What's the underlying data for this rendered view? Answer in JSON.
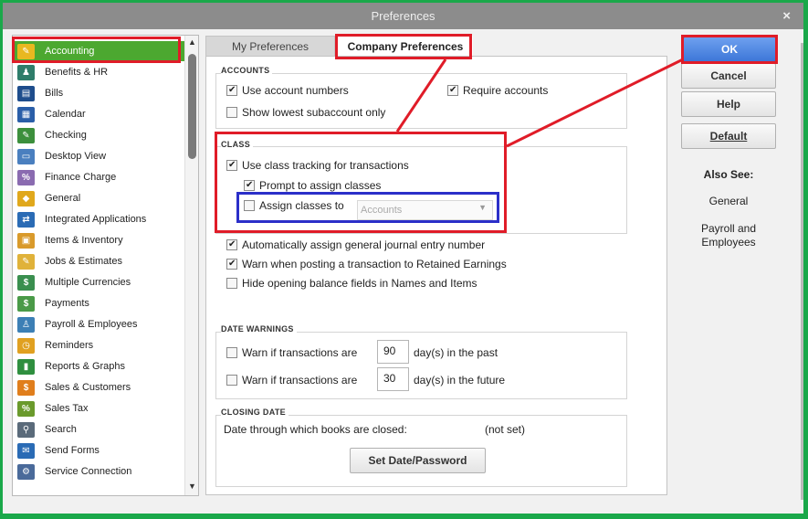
{
  "window": {
    "title": "Preferences",
    "close_glyph": "×"
  },
  "sidebar": {
    "items": [
      {
        "label": "Accounting",
        "icon": "accounting-icon",
        "color": "#e8b820",
        "glyph": "✎"
      },
      {
        "label": "Benefits & HR",
        "icon": "benefits-hr-icon",
        "color": "#2f7d6a",
        "glyph": "♟"
      },
      {
        "label": "Bills",
        "icon": "bills-icon",
        "color": "#1e4d8c",
        "glyph": "▤"
      },
      {
        "label": "Calendar",
        "icon": "calendar-icon",
        "color": "#2a5ea8",
        "glyph": "▦"
      },
      {
        "label": "Checking",
        "icon": "checking-icon",
        "color": "#3c8f3c",
        "glyph": "✎"
      },
      {
        "label": "Desktop View",
        "icon": "desktop-view-icon",
        "color": "#4a7fbf",
        "glyph": "▭"
      },
      {
        "label": "Finance Charge",
        "icon": "finance-charge-icon",
        "color": "#8a6bb0",
        "glyph": "%"
      },
      {
        "label": "General",
        "icon": "general-icon",
        "color": "#e0a81c",
        "glyph": "◆"
      },
      {
        "label": "Integrated Applications",
        "icon": "integrated-apps-icon",
        "color": "#2a6bb5",
        "glyph": "⇄"
      },
      {
        "label": "Items & Inventory",
        "icon": "items-inventory-icon",
        "color": "#d99a2b",
        "glyph": "▣"
      },
      {
        "label": "Jobs & Estimates",
        "icon": "jobs-estimates-icon",
        "color": "#e0b23a",
        "glyph": "✎"
      },
      {
        "label": "Multiple Currencies",
        "icon": "multiple-currencies-icon",
        "color": "#3a8f4f",
        "glyph": "$"
      },
      {
        "label": "Payments",
        "icon": "payments-icon",
        "color": "#4a9a48",
        "glyph": "$"
      },
      {
        "label": "Payroll & Employees",
        "icon": "payroll-employees-icon",
        "color": "#3c7fb5",
        "glyph": "♙"
      },
      {
        "label": "Reminders",
        "icon": "reminders-icon",
        "color": "#e0a020",
        "glyph": "◷"
      },
      {
        "label": "Reports & Graphs",
        "icon": "reports-graphs-icon",
        "color": "#2f8f3f",
        "glyph": "▮"
      },
      {
        "label": "Sales & Customers",
        "icon": "sales-customers-icon",
        "color": "#e07e1c",
        "glyph": "$"
      },
      {
        "label": "Sales Tax",
        "icon": "sales-tax-icon",
        "color": "#6a9a2c",
        "glyph": "%"
      },
      {
        "label": "Search",
        "icon": "search-icon",
        "color": "#5a6a7a",
        "glyph": "⚲"
      },
      {
        "label": "Send Forms",
        "icon": "send-forms-icon",
        "color": "#2a6bb5",
        "glyph": "✉"
      },
      {
        "label": "Service Connection",
        "icon": "service-connection-icon",
        "color": "#4a6a9a",
        "glyph": "⚙"
      }
    ],
    "selected": "Accounting",
    "scroll_up": "▲",
    "scroll_down": "▼"
  },
  "tabs": {
    "my": "My Preferences",
    "company": "Company Preferences"
  },
  "accounts": {
    "title": "ACCOUNTS",
    "use_account_numbers": {
      "label": "Use account numbers",
      "checked": true
    },
    "require_accounts": {
      "label": "Require accounts",
      "checked": true
    },
    "show_lowest": {
      "label": "Show lowest subaccount only",
      "checked": false
    }
  },
  "class": {
    "title": "CLASS",
    "use_class_tracking": {
      "label": "Use class tracking for transactions",
      "checked": true
    },
    "prompt_assign": {
      "label": "Prompt to assign classes",
      "checked": true
    },
    "assign_classes_to": {
      "label": "Assign classes to",
      "checked": false,
      "value": "Accounts"
    }
  },
  "misc": {
    "auto_journal": {
      "label": "Automatically assign general journal entry number",
      "checked": true
    },
    "warn_retained": {
      "label": "Warn when posting a transaction to Retained Earnings",
      "checked": true
    },
    "hide_opening": {
      "label": "Hide opening balance fields in Names and Items",
      "checked": false
    }
  },
  "date_warnings": {
    "title": "DATE WARNINGS",
    "past": {
      "label": "Warn if transactions are",
      "value": "90",
      "suffix": "day(s) in the past",
      "checked": false
    },
    "future": {
      "label": "Warn if transactions are",
      "value": "30",
      "suffix": "day(s) in the future",
      "checked": false
    }
  },
  "closing_date": {
    "title": "CLOSING DATE",
    "label": "Date through which books are closed:",
    "value": "(not set)",
    "button": "Set Date/Password"
  },
  "buttons": {
    "ok": "OK",
    "cancel": "Cancel",
    "help": "Help",
    "default": "Default"
  },
  "also_see": {
    "title": "Also See:",
    "links": [
      "General",
      "Payroll and\nEmployees"
    ]
  },
  "colors": {
    "annotation_red": "#e01c28",
    "annotation_blue": "#2b2fc9",
    "selected_green": "#4ca830",
    "ok_blue": "#3d77d8"
  }
}
